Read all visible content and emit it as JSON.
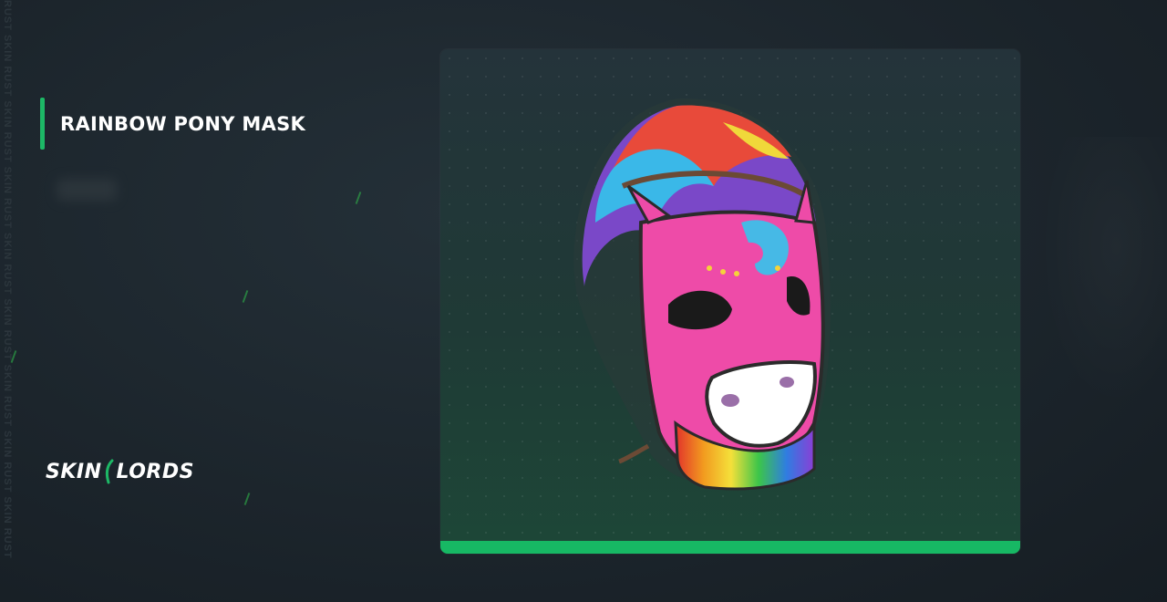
{
  "watermark": "RUST SKIN RUST SKIN RUST SKIN RUST SKIN RUST SKIN RUST SKIN RUST SKIN RUST SKIN RUST",
  "item": {
    "title": "RAINBOW PONY MASK"
  },
  "logo": {
    "part1": "SKIN",
    "part2": "LORDS"
  },
  "colors": {
    "accent": "#1db866",
    "card_bar": "#17b864",
    "background": "#1c252c"
  },
  "icons": {
    "item_image": "rainbow-pony-mask-icon",
    "logo_mark": "skinlords-slash-icon"
  }
}
